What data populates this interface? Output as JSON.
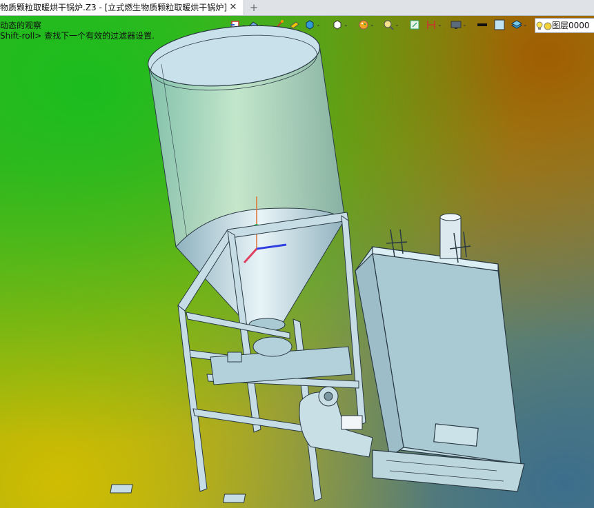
{
  "tab": {
    "title": "物质颗粒取暖烘干锅炉.Z3 - [立式燃生物质颗粒取暖烘干锅炉]",
    "close_glyph": "✕",
    "add_glyph": "+"
  },
  "hints": {
    "line1": "动态的观察",
    "line2": "Shift-roll> 查找下一个有效的过滤器设置."
  },
  "toolbar": {
    "icons": [
      "view-direction-icon",
      "render-mode-icon",
      "sketch-pen-icon",
      "material-icon",
      "box-3d-icon",
      "solid-icon",
      "palette-icon",
      "zoom-icon",
      "fit-icon",
      "section-icon",
      "display-icon",
      "line-color-icon",
      "fill-color-icon",
      "layer-stack-icon"
    ],
    "dropdown_glyph": "⌄"
  },
  "layer": {
    "label": "图层0000"
  },
  "colors": {
    "part_fill": "#b9d6e0",
    "part_edge": "#2a3a44",
    "accent_axis_y": "#e07030"
  }
}
